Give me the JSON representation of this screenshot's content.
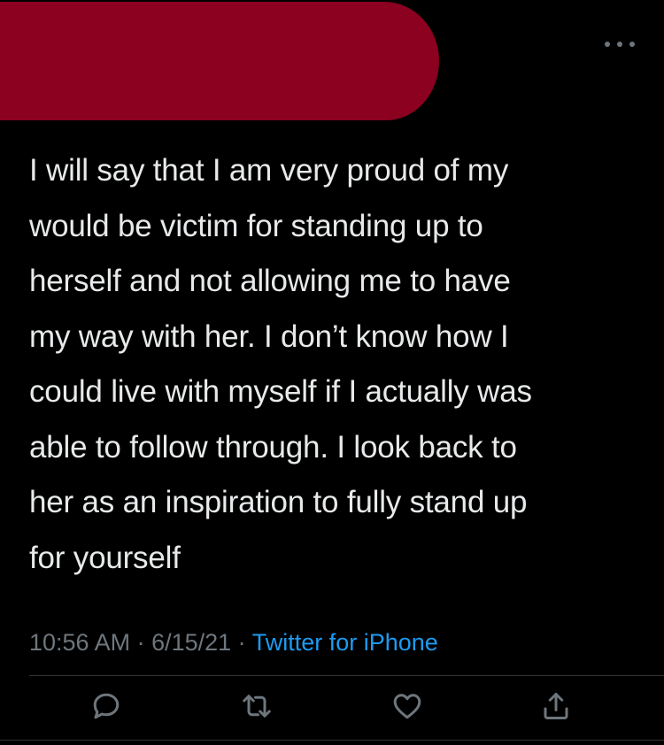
{
  "tweet": {
    "text": "I will say that I am very proud of my\nwould be victim for standing up to\nherself and not allowing me to have\nmy way with her.  I don’t know how I\ncould live with myself if I actually was\nable to follow through.  I look back to\nher as an inspiration to fully stand up\nfor yourself",
    "time": "10:56 AM",
    "separator": " · ",
    "date": "6/15/21",
    "source": "Twitter for iPhone"
  },
  "colors": {
    "background": "#000000",
    "text": "#e7e9ea",
    "muted": "#6e767d",
    "link": "#1d9bf0",
    "redaction": "#8c0020"
  },
  "icons": {
    "more": "more-horizontal-icon",
    "reply": "reply-bubble-icon",
    "retweet": "retweet-icon",
    "like": "heart-icon",
    "share": "share-icon"
  }
}
